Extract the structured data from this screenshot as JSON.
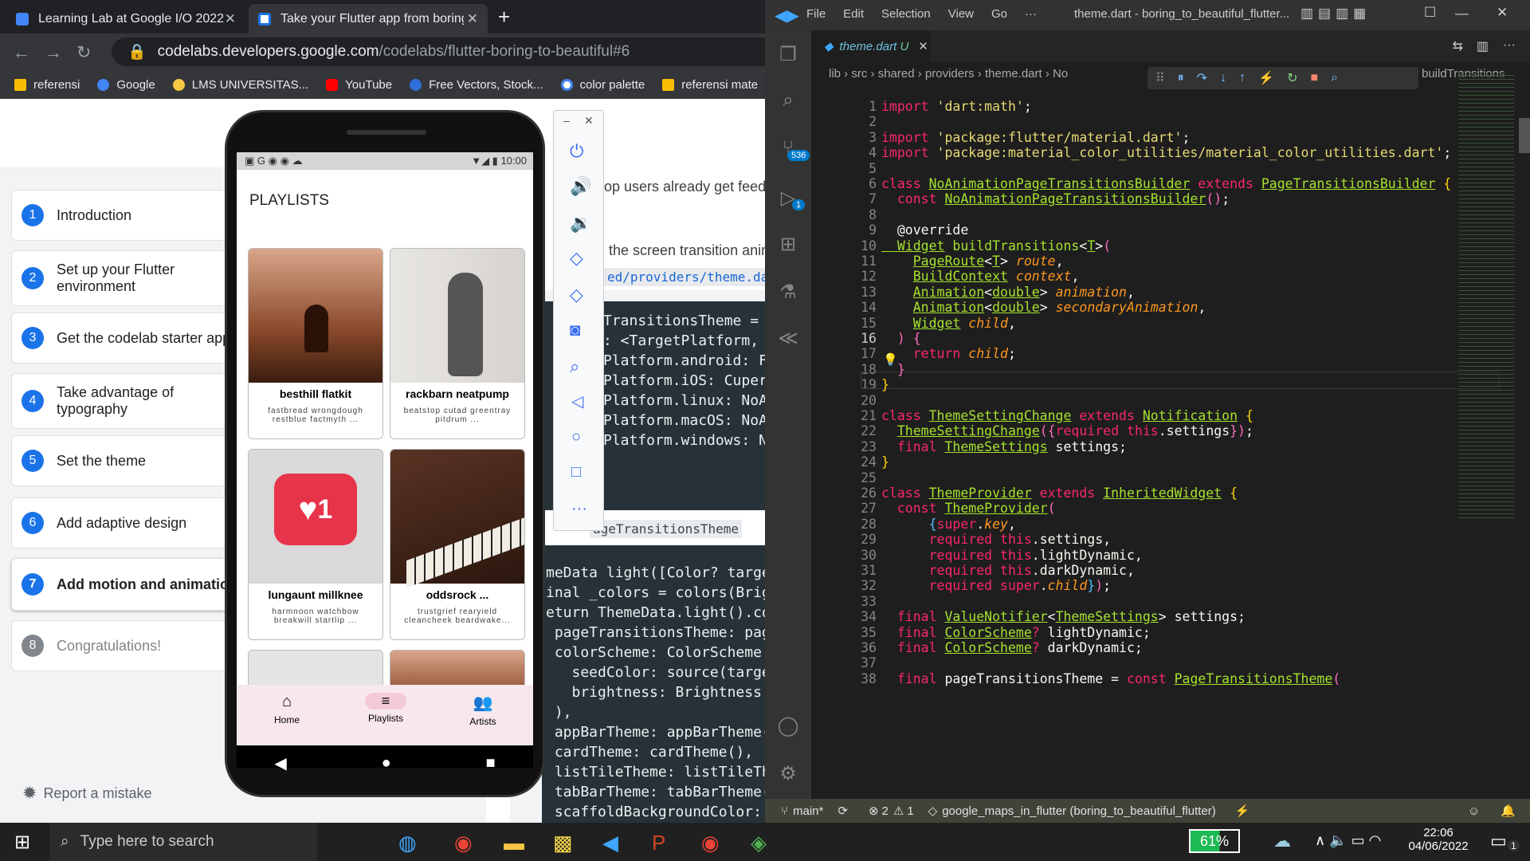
{
  "browser": {
    "tabs": [
      {
        "title": "Learning Lab at Google I/O 2022"
      },
      {
        "title": "Take your Flutter app from boring"
      }
    ],
    "url_host": "codelabs.developers.google.com",
    "url_path": "/codelabs/flutter-boring-to-beautiful#6",
    "bookmarks": [
      "referensi",
      "Google",
      "LMS UNIVERSITAS...",
      "YouTube",
      "Free Vectors, Stock...",
      "color palette",
      "referensi mate"
    ]
  },
  "codelab": {
    "steps": [
      {
        "num": "1",
        "label": "Introduction"
      },
      {
        "num": "2",
        "label": "Set up your Flutter environment"
      },
      {
        "num": "3",
        "label": "Get the codelab starter app"
      },
      {
        "num": "4",
        "label": "Take advantage of typography"
      },
      {
        "num": "5",
        "label": "Set the theme"
      },
      {
        "num": "6",
        "label": "Add adaptive design"
      },
      {
        "num": "7",
        "label": "Add motion and animation"
      },
      {
        "num": "8",
        "label": "Congratulations!"
      }
    ],
    "report": "Report a mistake",
    "text1": "op users already get feedb",
    "text2": "the screen transition anim",
    "path": "ed/providers/theme.dart",
    "inline_code": "ageTransitionsTheme",
    "code_top": [
      "TransitionsTheme = c",
      ": <TargetPlatform, P",
      "Platform.android: Fa",
      "Platform.iOS: Cupert",
      "Platform.linux: NoAn",
      "Platform.macOS: NoAn",
      "Platform.windows: No"
    ],
    "code_bottom": [
      "meData light([Color? target",
      "inal _colors = colors(Brigh",
      "eturn ThemeData.light().cop",
      " pageTransitionsTheme: page",
      " colorScheme: ColorScheme.f",
      "   seedColor: source(target",
      "   brightness: Brightness.l",
      " ),",
      " appBarTheme: appBarTheme(_",
      " cardTheme: cardTheme(),",
      " listTileTheme: listTileThe",
      " tabBarTheme: tabBarTheme(_",
      " scaffoldBackgroundColor: _"
    ]
  },
  "phone": {
    "status_time": "10:00",
    "title": "PLAYLISTS",
    "cards": [
      {
        "title": "besthill flatkit",
        "sub": "fastbread wrongdough restblue factmyth ..."
      },
      {
        "title": "rackbarn neatpump",
        "sub": "beatstop cutad greentray pitdrum ..."
      },
      {
        "title": "lungaunt millknee",
        "sub": "harmnoon watchbow breakwill startlip ..."
      },
      {
        "title": "oddsrock ...",
        "sub": "trustgrief rearyield cleancheek beardwake..."
      }
    ],
    "heart_count": "1",
    "nav": [
      {
        "label": "Home"
      },
      {
        "label": "Playlists"
      },
      {
        "label": "Artists"
      }
    ]
  },
  "vscode": {
    "menu": [
      "File",
      "Edit",
      "Selection",
      "View",
      "Go",
      "···"
    ],
    "title": "theme.dart - boring_to_beautiful_flutter...",
    "tab": "theme.dart",
    "tab_status": "U",
    "crumbs": [
      "lib",
      "src",
      "shared",
      "providers",
      "theme.dart",
      "No"
    ],
    "crumb_right": "buildTransitions",
    "scm_badge": "536",
    "debug_badge": "1",
    "lines": [
      "1",
      "2",
      "3",
      "4",
      "5",
      "6",
      "7",
      "8",
      "9",
      "10",
      "11",
      "12",
      "13",
      "14",
      "15",
      "16",
      "17",
      "18",
      "19",
      "20",
      "21",
      "22",
      "23",
      "24",
      "25",
      "26",
      "27",
      "28",
      "29",
      "30",
      "31",
      "32",
      "33",
      "34",
      "35",
      "36",
      "37",
      "38"
    ],
    "status": {
      "branch": "main*",
      "errors": "2",
      "warnings": "1",
      "project": "google_maps_in_flutter (boring_to_beautiful_flutter)"
    }
  },
  "taskbar": {
    "search": "Type here to search",
    "battery": "61%",
    "time": "22:06",
    "date": "04/06/2022",
    "notif": "1"
  }
}
